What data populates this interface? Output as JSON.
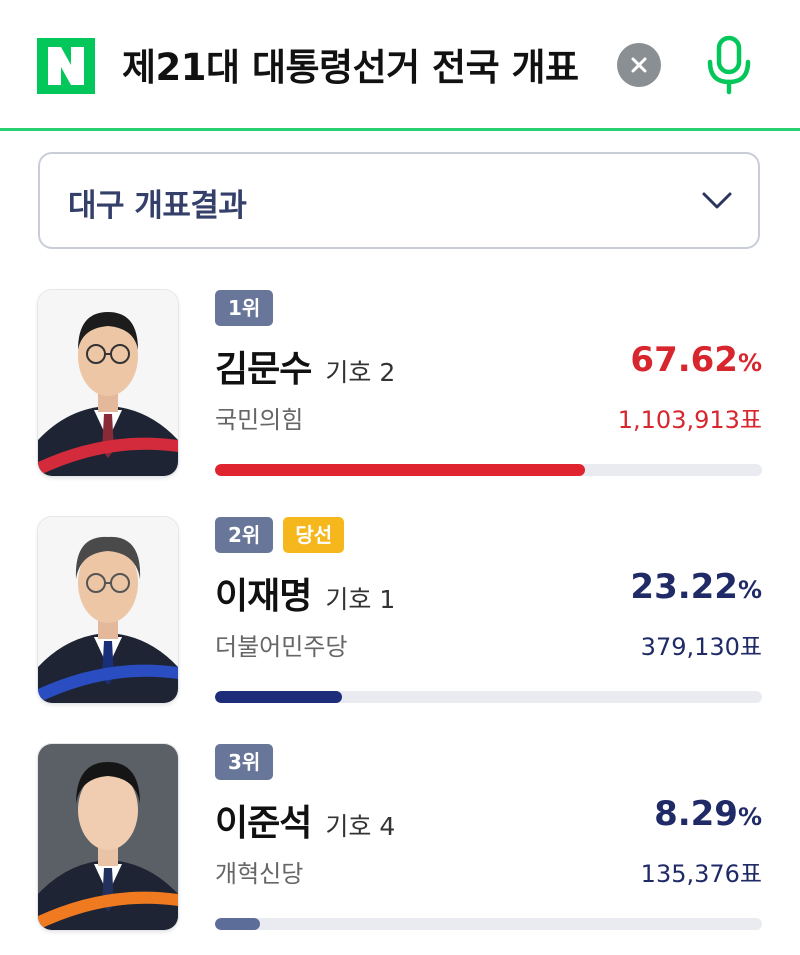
{
  "search": {
    "logo_letter": "N",
    "query": "제21대 대통령선거 전국 개표",
    "brand_color": "#03c75a"
  },
  "region_select": {
    "label": "대구 개표결과"
  },
  "candidates": [
    {
      "rank": "1위",
      "winner_badge": "",
      "name": "김문수",
      "number": "기호 2",
      "party": "국민의힘",
      "percent": "67.62",
      "percent_unit": "%",
      "votes": "1,103,913표",
      "share": 0.6762,
      "color": "#d8262f",
      "accent": "#d32b3b",
      "bar_color": "#e0242f"
    },
    {
      "rank": "2위",
      "winner_badge": "당선",
      "name": "이재명",
      "number": "기호 1",
      "party": "더불어민주당",
      "percent": "23.22",
      "percent_unit": "%",
      "votes": "379,130표",
      "share": 0.2322,
      "color": "#1f2a66",
      "accent": "#2a4ec2",
      "bar_color": "#1d2d7a"
    },
    {
      "rank": "3위",
      "winner_badge": "",
      "name": "이준석",
      "number": "기호 4",
      "party": "개혁신당",
      "percent": "8.29",
      "percent_unit": "%",
      "votes": "135,376표",
      "share": 0.0829,
      "color": "#1f2a66",
      "accent": "#f07a1f",
      "bar_color": "#5d6d99"
    }
  ]
}
